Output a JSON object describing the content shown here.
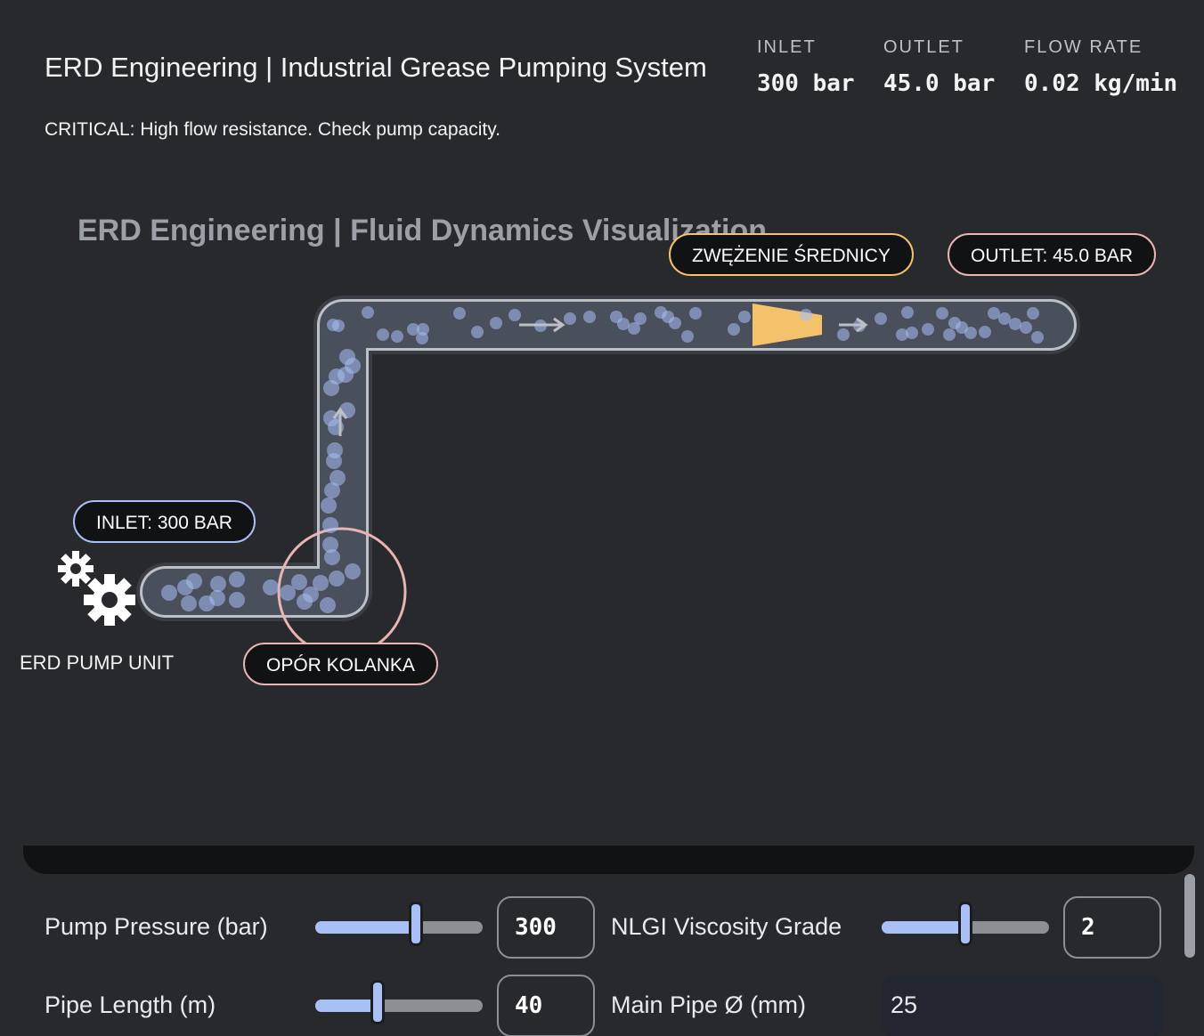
{
  "header": {
    "title": "ERD Engineering | Industrial Grease Pumping System",
    "alert": "CRITICAL: High flow resistance. Check pump capacity.",
    "stats": [
      {
        "label": "INLET",
        "value": "300 bar"
      },
      {
        "label": "OUTLET",
        "value": "45.0 bar"
      },
      {
        "label": "FLOW RATE",
        "value": "0.02 kg/min"
      }
    ]
  },
  "visualization": {
    "title": "ERD Engineering | Fluid Dynamics Visualization",
    "tags": {
      "constriction": "ZWĘŻENIE ŚREDNICY",
      "outlet": "OUTLET: 45.0 BAR",
      "inlet": "INLET: 300 BAR",
      "elbow": "OPÓR KOLANKA"
    },
    "pump_label": "ERD PUMP UNIT",
    "icons": [
      "gear-icon",
      "gear-icon",
      "arrow-right-icon",
      "arrow-up-icon"
    ],
    "colors": {
      "constriction": "#f3c26b",
      "elbow_ring": "#e8b4b4",
      "inlet_ring": "#a8c0f5",
      "particles": "#a8c0f5",
      "pipe_wall": "#bdc1c6"
    }
  },
  "controls": {
    "pump_pressure": {
      "label": "Pump Pressure (bar)",
      "value": "300",
      "fraction": 0.6
    },
    "nlgi_grade": {
      "label": "NLGI Viscosity Grade",
      "value": "2",
      "fraction": 0.5
    },
    "pipe_length": {
      "label": "Pipe Length (m)",
      "value": "40",
      "fraction": 0.37
    },
    "main_pipe_diameter": {
      "label": "Main Pipe Ø (mm)",
      "value": "25"
    }
  }
}
